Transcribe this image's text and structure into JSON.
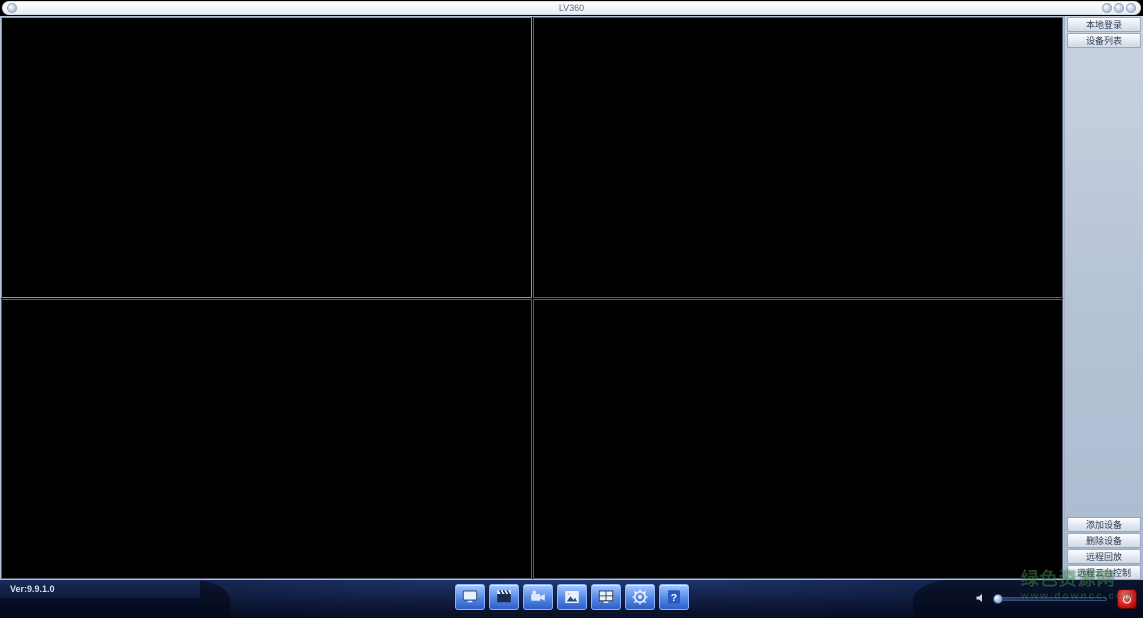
{
  "titlebar": {
    "title": "LV360"
  },
  "sidebar": {
    "top": [
      {
        "label": "本地登录"
      },
      {
        "label": "设备列表"
      }
    ],
    "bottom": [
      {
        "label": "添加设备"
      },
      {
        "label": "删除设备"
      },
      {
        "label": "远程回放"
      },
      {
        "label": "远程云台控制"
      }
    ]
  },
  "grid": {
    "layout": "2x2",
    "selected_index": 0,
    "cells": [
      {},
      {},
      {},
      {}
    ]
  },
  "toolbar": {
    "buttons": [
      {
        "name": "single-view"
      },
      {
        "name": "record"
      },
      {
        "name": "camera"
      },
      {
        "name": "snapshot"
      },
      {
        "name": "multi-view"
      },
      {
        "name": "settings"
      },
      {
        "name": "help"
      }
    ]
  },
  "status": {
    "version_prefix": "Ver: ",
    "version": "9.9.1.0"
  },
  "audio": {
    "volume_percent": 0
  },
  "watermark": {
    "line1": "绿色资源网",
    "line2": "www.downcc.com"
  }
}
